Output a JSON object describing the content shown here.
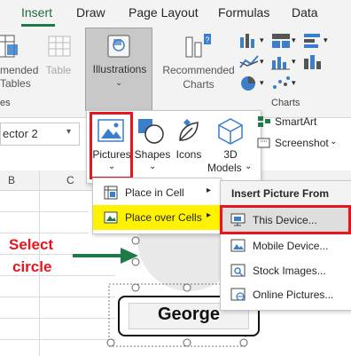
{
  "tabs": [
    "Insert",
    "Draw",
    "Page Layout",
    "Formulas",
    "Data"
  ],
  "ribbon": {
    "recommended_partial": [
      "mended",
      "Tables"
    ],
    "table_label": "Table",
    "illustrations_label": "Illustrations",
    "recommended_charts": [
      "Recommended",
      "Charts"
    ],
    "group_left_partial": "es",
    "group_charts": "Charts"
  },
  "namebox": {
    "value": "ector 2"
  },
  "columns": [
    "B",
    "C"
  ],
  "illustrations_menu": {
    "pictures": "Pictures",
    "shapes": "Shapes",
    "icons": "Icons",
    "models_line1": "3D",
    "models_line2": "Models",
    "smartart": "SmartArt",
    "screenshot": "Screenshot"
  },
  "pictures_menu": {
    "place_in_cell": "Place in Cell",
    "place_over_cells": "Place over Cells"
  },
  "insert_picture_from": {
    "header": "Insert Picture From",
    "items": [
      "This Device...",
      "Mobile Device...",
      "Stock Images...",
      "Online Pictures..."
    ]
  },
  "annotation": {
    "line1": "Select",
    "line2": "circle"
  },
  "shape_text": "George",
  "colors": {
    "highlight_red": "#e8141e",
    "hover_yellow": "#fff200",
    "accent_green": "#1e7a46"
  }
}
